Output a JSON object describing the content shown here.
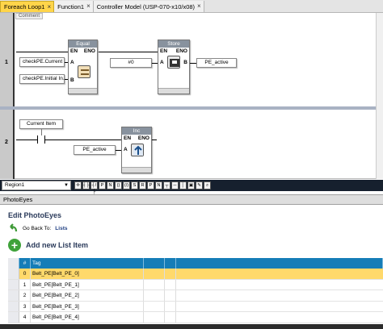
{
  "tabs": [
    {
      "label": "Foreach Loop1",
      "active": true
    },
    {
      "label": "Function1",
      "active": false
    },
    {
      "label": "Controller Model (USP-070-x10/x08)",
      "active": false
    }
  ],
  "ladder": {
    "comment_label": "Comment",
    "rungs": [
      {
        "number": "1"
      },
      {
        "number": "2"
      }
    ],
    "equal_block": {
      "title": "Equal",
      "en": "EN",
      "eno": "ENO",
      "in_a": "A",
      "in_b": "B"
    },
    "store_block": {
      "title": "Store",
      "en": "EN",
      "eno": "ENO",
      "in_a": "A",
      "out_b": "B"
    },
    "inc_block": {
      "title": "Inc",
      "en": "EN",
      "eno": "ENO",
      "in_a": "A"
    },
    "vars": {
      "check_current": "checkPE.Current ...",
      "check_initial": "checkPE.Initial In...",
      "const_zero": "#0",
      "pe_active_store": "PE_active",
      "current_item": "Current Item",
      "pe_active_inc": "PE_active"
    }
  },
  "toolbar": {
    "region_value": "Region1",
    "icons": [
      "crosshair-icon",
      "contact-no-icon",
      "contact-nc-icon",
      "contact-p-icon",
      "contact-n-icon",
      "coil-icon",
      "coil-n-icon",
      "set-coil-icon",
      "reset-coil-icon",
      "coil-p-icon",
      "coil-neg-icon",
      "branch-icon",
      "wire-icon",
      "wire-v-icon",
      "block-icon",
      "comment-icon",
      "zoom-icon"
    ]
  },
  "panel": {
    "title": "PhotoEyes",
    "edit_title": "Edit PhotoEyes",
    "go_back_label": "Go Back To:",
    "go_back_link": "Lists",
    "add_new_label": "Add new List Item",
    "columns": {
      "num": "#",
      "tag": "Tag"
    },
    "rows": [
      {
        "num": "0",
        "tag": "Belt_PE[Belt_PE_0]",
        "selected": true
      },
      {
        "num": "1",
        "tag": "Belt_PE[Belt_PE_1]",
        "selected": false
      },
      {
        "num": "2",
        "tag": "Belt_PE[Belt_PE_2]",
        "selected": false
      },
      {
        "num": "3",
        "tag": "Belt_PE[Belt_PE_3]",
        "selected": false
      },
      {
        "num": "4",
        "tag": "Belt_PE[Belt_PE_4]",
        "selected": false
      }
    ]
  },
  "colors": {
    "active_tab": "#ffd54a",
    "grid_header": "#157db7",
    "selected_row": "#ffd96b",
    "toolbar_bg": "#16202e"
  }
}
